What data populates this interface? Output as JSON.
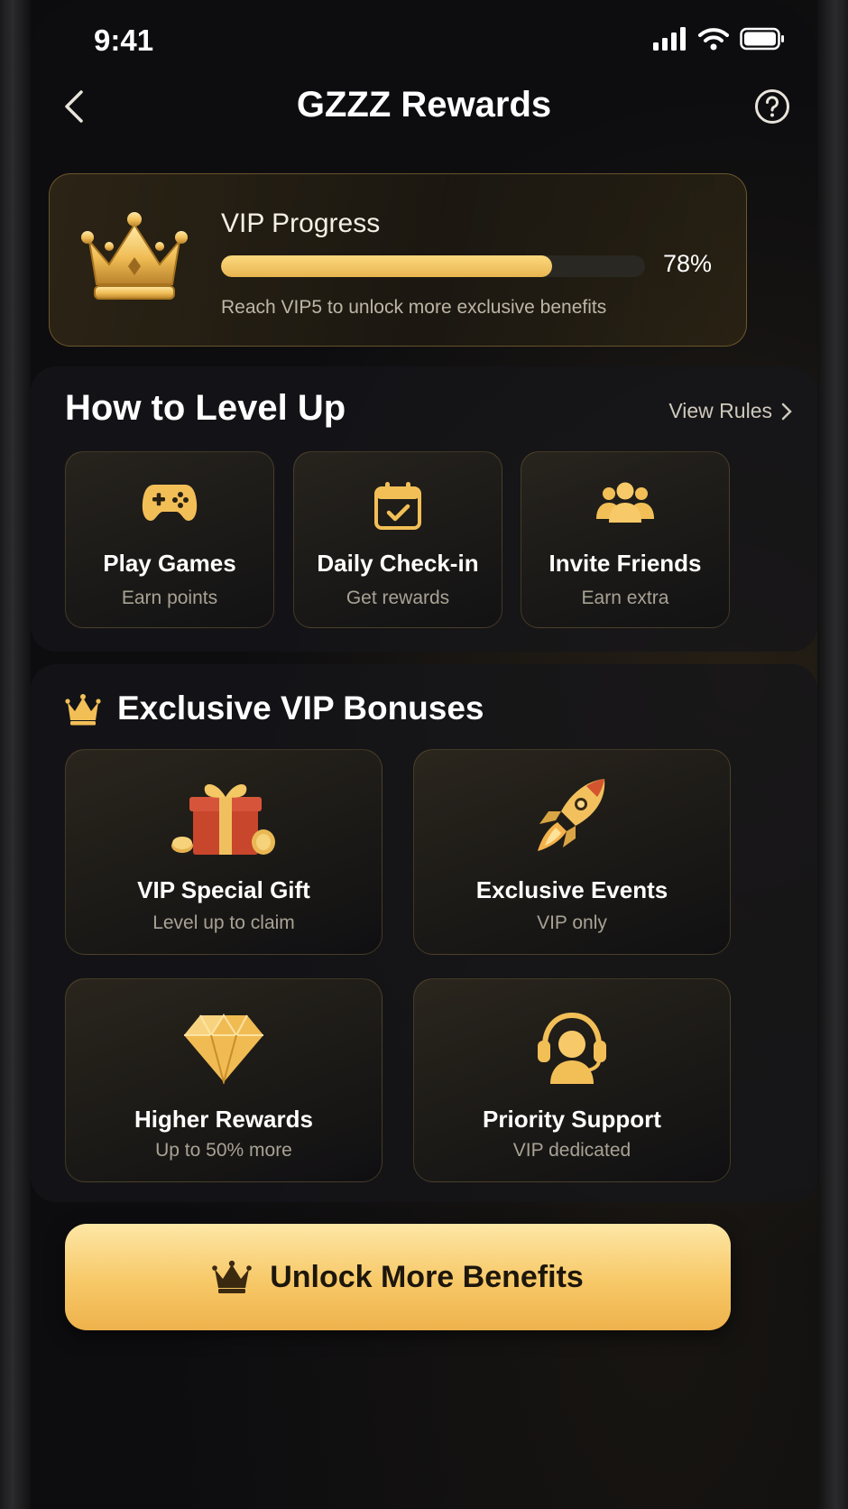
{
  "status_bar": {
    "time": "9:41"
  },
  "header": {
    "title": "GZZZ Rewards",
    "back_icon": "chevron-left-icon",
    "help_icon": "question-circle-icon"
  },
  "vip_progress": {
    "title": "VIP Progress",
    "percent": 78,
    "percent_label": "78%",
    "subtitle": "Reach VIP5 to unlock more exclusive benefits"
  },
  "level_up": {
    "title": "How to Level Up",
    "view_rules": "View Rules",
    "steps": [
      {
        "icon": "gamepad-icon",
        "title": "Play Games",
        "subtitle": "Earn points"
      },
      {
        "icon": "calendar-check-icon",
        "title": "Daily Check-in",
        "subtitle": "Get rewards"
      },
      {
        "icon": "users-icon",
        "title": "Invite Friends",
        "subtitle": "Earn extra"
      }
    ]
  },
  "bonuses": {
    "title": "Exclusive VIP Bonuses",
    "items": [
      {
        "icon": "gift-icon",
        "title": "VIP Special Gift",
        "subtitle": "Level up to claim"
      },
      {
        "icon": "rocket-icon",
        "title": "Exclusive Events",
        "subtitle": "VIP only"
      },
      {
        "icon": "diamond-icon",
        "title": "Higher Rewards",
        "subtitle": "Up to 50% more"
      },
      {
        "icon": "headset-icon",
        "title": "Priority Support",
        "subtitle": "VIP dedicated"
      }
    ]
  },
  "cta": {
    "label": "Unlock More Benefits",
    "icon": "crown-icon"
  },
  "colors": {
    "gold": "#f2c15e",
    "background": "#0d0d10",
    "card_border": "#7a643c"
  }
}
